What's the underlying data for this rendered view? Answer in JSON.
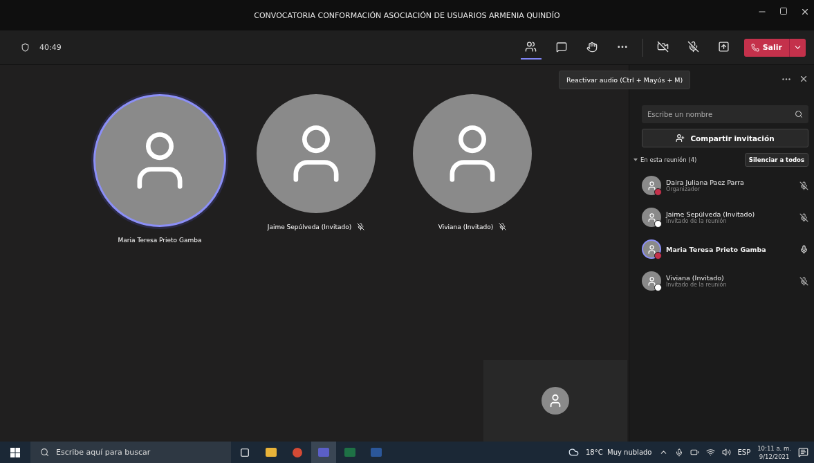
{
  "window": {
    "title": "CONVOCATORIA CONFORMACIÓN ASOCIACIÓN DE USUARIOS ARMENIA QUINDÍO"
  },
  "toolbar": {
    "timer": "40:49",
    "participants_active": true,
    "leave_label": "Salir",
    "camera_on": false,
    "mic_muted": true
  },
  "tooltip": "Reactivar audio (Ctrl + Mayús + M)",
  "tiles": [
    {
      "name": "Maria Teresa Prieto Gamba",
      "speaking": true,
      "muted": false
    },
    {
      "name": "Jaime Sepúlveda (Invitado)",
      "speaking": false,
      "muted": true
    },
    {
      "name": "Viviana (Invitado)",
      "speaking": false,
      "muted": true
    }
  ],
  "panel": {
    "search_placeholder": "Escribe un nombre",
    "share_label": "Compartir invitación",
    "section": "En esta reunión (4)",
    "expanded": true,
    "mute_all": "Silenciar a todos",
    "participants": [
      {
        "name": "Daira Juliana Paez Parra",
        "role": "Organizador",
        "color": "#c4314b",
        "muted": true,
        "speaking": false
      },
      {
        "name": "Jaime Sepúlveda (Invitado)",
        "role": "Invitado de la reunión",
        "color": "#ffffff",
        "muted": true,
        "speaking": false
      },
      {
        "name": "Maria Teresa Prieto Gamba",
        "color": "#c4314b",
        "muted": false,
        "speaking": true
      },
      {
        "name": "Viviana (Invitado)",
        "role": "Invitado de la reunión",
        "color": "#ffffff",
        "muted": true,
        "speaking": false
      }
    ]
  },
  "taskbar": {
    "search_placeholder": "Escribe aquí para buscar",
    "weather": "18°C  Muy nublado",
    "language": "ESP",
    "time": "10:11 a. m.",
    "date": "9/12/2021"
  }
}
